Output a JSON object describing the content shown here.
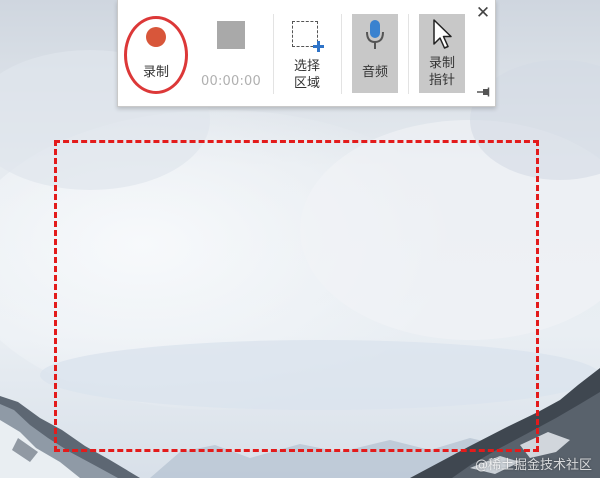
{
  "toolbar": {
    "record_label": "录制",
    "timer": "00:00:00",
    "select_area_line1": "选择",
    "select_area_line2": "区域",
    "audio_label": "音频",
    "pointer_label_line1": "录制",
    "pointer_label_line2": "指针",
    "close_icon": "close-icon",
    "pin_icon": "pin-icon"
  },
  "colors": {
    "record_dot": "#d8563a",
    "highlight_ring": "#dc3838",
    "selection_border": "#e31b1b",
    "toggle_active_bg": "#c8c8c8",
    "accent_blue": "#2f74c8"
  },
  "watermark": "@稀土掘金技术社区"
}
